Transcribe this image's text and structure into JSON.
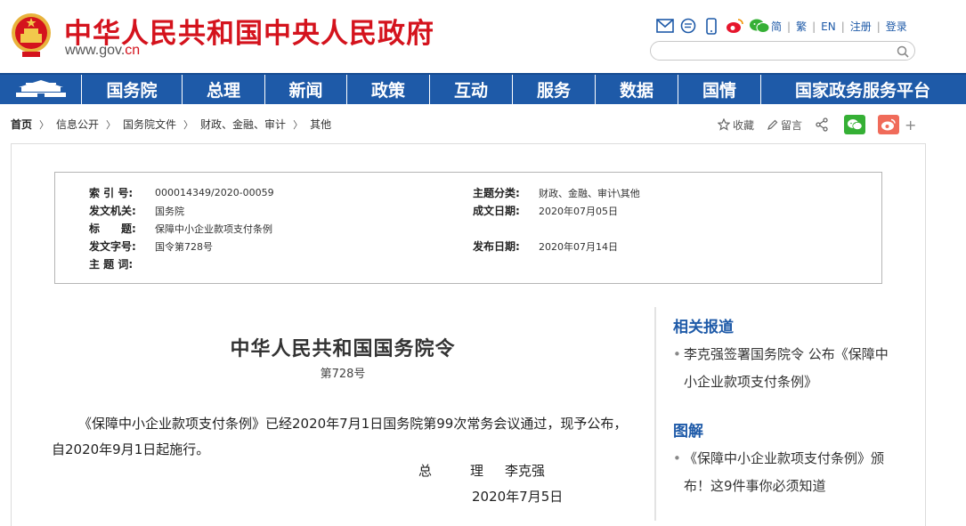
{
  "site": {
    "name": "中华人民共和国中央人民政府",
    "domain_prefix": "www.gov.",
    "domain_suffix": "cn"
  },
  "top_links": {
    "simplified": "简",
    "traditional": "繁",
    "english": "EN",
    "register": "注册",
    "login": "登录",
    "search_placeholder": ""
  },
  "nav": {
    "items": [
      "国务院",
      "总理",
      "新闻",
      "政策",
      "互动",
      "服务",
      "数据",
      "国情",
      "国家政务服务平台"
    ]
  },
  "breadcrumb": {
    "items": [
      "首页",
      "信息公开",
      "国务院文件",
      "财政、金融、审计",
      "其他"
    ]
  },
  "tools": {
    "favorite": "收藏",
    "comment": "留言",
    "more": "+"
  },
  "info": {
    "index_label": "索 引 号:",
    "index_value": "000014349/2020-00059",
    "category_label": "主题分类:",
    "category_value": "财政、金融、审计\\其他",
    "issuer_label": "发文机关:",
    "issuer_value": "国务院",
    "created_label": "成文日期:",
    "created_value": "2020年07月05日",
    "title_label": "标　　题:",
    "title_value": "保障中小企业款项支付条例",
    "docno_label": "发文字号:",
    "docno_value": "国令第728号",
    "published_label": "发布日期:",
    "published_value": "2020年07月14日",
    "keywords_label": "主 题 词:",
    "keywords_value": ""
  },
  "article": {
    "title": "中华人民共和国国务院令",
    "number": "第728号",
    "body": "《保障中小企业款项支付条例》已经2020年7月1日国务院第99次常务会议通过，现予公布，自2020年9月1日起施行。",
    "signer_role": "总　理",
    "signer_name": "李克强",
    "date": "2020年7月5日"
  },
  "sidebar": {
    "related_heading": "相关报道",
    "related_items": [
      "李克强签署国务院令 公布《保障中小企业款项支付条例》"
    ],
    "graphic_heading": "图解",
    "graphic_items": [
      "《保障中小企业款项支付条例》颁布！这9件事你必须知道"
    ]
  },
  "colors": {
    "brand_red": "#d4131d",
    "nav_blue": "#1e5aa8",
    "wechat_green": "#35b035",
    "weibo_red": "#f06b5a"
  }
}
